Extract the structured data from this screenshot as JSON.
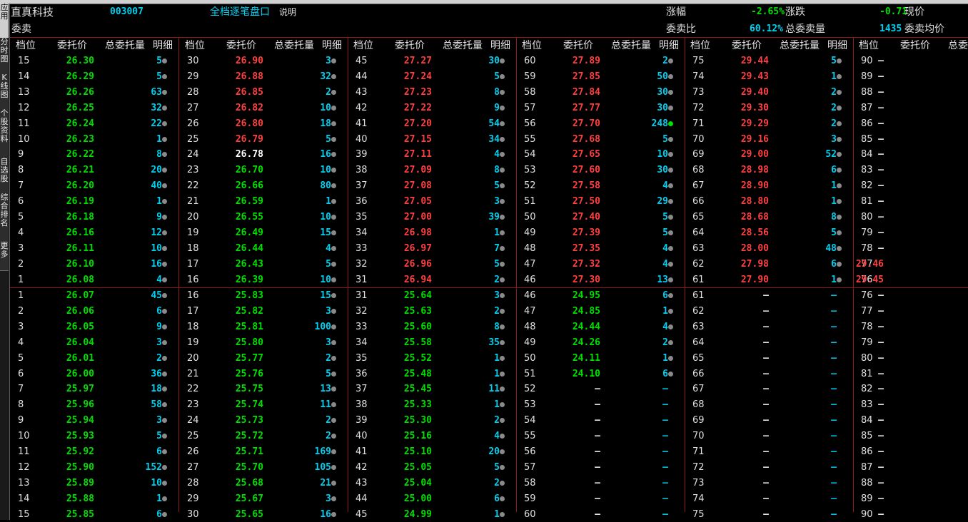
{
  "header": {
    "stock_name": "直真科技",
    "stock_code": "003007",
    "mode_title": "全档逐笔盘口",
    "help_link": "说明",
    "change_pct_label": "涨幅",
    "change_pct_value": "-2.65%",
    "change_label": "涨跌",
    "change_value": "-0.71",
    "price_label": "现价",
    "sell_label": "委卖",
    "sell_ratio_label": "委卖比",
    "sell_ratio_value": "60.12%",
    "sell_total_label": "总委卖量",
    "sell_total_value": "1435",
    "sell_avg_label": "委卖均价"
  },
  "sidebar_tabs": [
    {
      "label": "应用",
      "active": true
    },
    {
      "label": "分时图",
      "active": false
    },
    {
      "label": "K线图",
      "active": false
    },
    {
      "label": "个股资料",
      "active": false
    },
    {
      "label": "自选股",
      "active": false
    },
    {
      "label": "综合排名",
      "active": false
    },
    {
      "label": "更多",
      "active": false
    }
  ],
  "column_headers": {
    "level": "档位",
    "price": "委托价",
    "volume": "总委托量",
    "detail": "明细"
  },
  "colors": {
    "up": "#ff4040",
    "down": "#00e000",
    "flat": "#ffffff",
    "volume": "#00d0f0",
    "dash_price": "#e0e0e0",
    "dash_volume": "#00c0e0"
  },
  "ask_columns": [
    [
      [
        "15",
        "26.30",
        "5",
        "down",
        1
      ],
      [
        "14",
        "26.29",
        "5",
        "down",
        1
      ],
      [
        "13",
        "26.26",
        "63",
        "down",
        1
      ],
      [
        "12",
        "26.25",
        "32",
        "down",
        1
      ],
      [
        "11",
        "26.24",
        "22",
        "down",
        1
      ],
      [
        "10",
        "26.23",
        "1",
        "down",
        1
      ],
      [
        "9",
        "26.22",
        "8",
        "down",
        1
      ],
      [
        "8",
        "26.21",
        "20",
        "down",
        1
      ],
      [
        "7",
        "26.20",
        "40",
        "down",
        1
      ],
      [
        "6",
        "26.19",
        "1",
        "down",
        1
      ],
      [
        "5",
        "26.18",
        "9",
        "down",
        1
      ],
      [
        "4",
        "26.16",
        "12",
        "down",
        1
      ],
      [
        "3",
        "26.11",
        "10",
        "down",
        1
      ],
      [
        "2",
        "26.10",
        "16",
        "down",
        1
      ],
      [
        "1",
        "26.08",
        "4",
        "down",
        1
      ]
    ],
    [
      [
        "30",
        "26.90",
        "3",
        "up",
        1
      ],
      [
        "29",
        "26.88",
        "32",
        "up",
        1
      ],
      [
        "28",
        "26.85",
        "2",
        "up",
        1
      ],
      [
        "27",
        "26.82",
        "10",
        "up",
        1
      ],
      [
        "26",
        "26.80",
        "18",
        "up",
        1
      ],
      [
        "25",
        "26.79",
        "5",
        "up",
        1
      ],
      [
        "24",
        "26.78",
        "16",
        "flat",
        1
      ],
      [
        "23",
        "26.70",
        "10",
        "down",
        1
      ],
      [
        "22",
        "26.66",
        "80",
        "down",
        1
      ],
      [
        "21",
        "26.59",
        "1",
        "down",
        1
      ],
      [
        "20",
        "26.55",
        "10",
        "down",
        1
      ],
      [
        "19",
        "26.49",
        "15",
        "down",
        1
      ],
      [
        "18",
        "26.44",
        "4",
        "down",
        1
      ],
      [
        "17",
        "26.43",
        "5",
        "down",
        1
      ],
      [
        "16",
        "26.39",
        "10",
        "down",
        1
      ]
    ],
    [
      [
        "45",
        "27.27",
        "30",
        "up",
        1
      ],
      [
        "44",
        "27.24",
        "5",
        "up",
        1
      ],
      [
        "43",
        "27.23",
        "8",
        "up",
        1
      ],
      [
        "42",
        "27.22",
        "9",
        "up",
        1
      ],
      [
        "41",
        "27.20",
        "54",
        "up",
        1
      ],
      [
        "40",
        "27.15",
        "34",
        "up",
        1
      ],
      [
        "39",
        "27.11",
        "4",
        "up",
        1
      ],
      [
        "38",
        "27.09",
        "8",
        "up",
        1
      ],
      [
        "37",
        "27.08",
        "5",
        "up",
        1
      ],
      [
        "36",
        "27.05",
        "3",
        "up",
        1
      ],
      [
        "35",
        "27.00",
        "39",
        "up",
        1
      ],
      [
        "34",
        "26.98",
        "1",
        "up",
        1
      ],
      [
        "33",
        "26.97",
        "7",
        "up",
        1
      ],
      [
        "32",
        "26.96",
        "5",
        "up",
        1
      ],
      [
        "31",
        "26.94",
        "2",
        "up",
        1
      ]
    ],
    [
      [
        "60",
        "27.89",
        "2",
        "up",
        1
      ],
      [
        "59",
        "27.85",
        "50",
        "up",
        1
      ],
      [
        "58",
        "27.84",
        "30",
        "up",
        1
      ],
      [
        "57",
        "27.77",
        "30",
        "up",
        1
      ],
      [
        "56",
        "27.70",
        "248",
        "up",
        2
      ],
      [
        "55",
        "27.68",
        "5",
        "up",
        1
      ],
      [
        "54",
        "27.65",
        "10",
        "up",
        1
      ],
      [
        "53",
        "27.60",
        "30",
        "up",
        1
      ],
      [
        "52",
        "27.58",
        "4",
        "up",
        1
      ],
      [
        "51",
        "27.50",
        "29",
        "up",
        1
      ],
      [
        "50",
        "27.40",
        "5",
        "up",
        1
      ],
      [
        "49",
        "27.39",
        "5",
        "up",
        1
      ],
      [
        "48",
        "27.35",
        "4",
        "up",
        1
      ],
      [
        "47",
        "27.32",
        "4",
        "up",
        1
      ],
      [
        "46",
        "27.30",
        "13",
        "up",
        1
      ]
    ],
    [
      [
        "75",
        "29.44",
        "5",
        "up",
        1
      ],
      [
        "74",
        "29.43",
        "1",
        "up",
        1
      ],
      [
        "73",
        "29.40",
        "2",
        "up",
        1
      ],
      [
        "72",
        "29.30",
        "2",
        "up",
        1
      ],
      [
        "71",
        "29.29",
        "2",
        "up",
        1
      ],
      [
        "70",
        "29.16",
        "3",
        "up",
        1
      ],
      [
        "69",
        "29.00",
        "52",
        "up",
        1
      ],
      [
        "68",
        "28.98",
        "6",
        "up",
        1
      ],
      [
        "67",
        "28.90",
        "1",
        "up",
        1
      ],
      [
        "66",
        "28.80",
        "1",
        "up",
        1
      ],
      [
        "65",
        "28.68",
        "8",
        "up",
        1
      ],
      [
        "64",
        "28.56",
        "5",
        "up",
        1
      ],
      [
        "63",
        "28.00",
        "48",
        "up",
        1
      ],
      [
        "62",
        "27.98",
        "6",
        "up",
        1
      ],
      [
        "61",
        "27.90",
        "1",
        "up",
        1
      ]
    ],
    [
      [
        "90",
        "–",
        "",
        "dash",
        0
      ],
      [
        "89",
        "–",
        "",
        "dash",
        0
      ],
      [
        "88",
        "–",
        "",
        "dash",
        0
      ],
      [
        "87",
        "–",
        "",
        "dash",
        0
      ],
      [
        "86",
        "–",
        "",
        "dash",
        0
      ],
      [
        "85",
        "–",
        "",
        "dash",
        0
      ],
      [
        "84",
        "–",
        "",
        "dash",
        0
      ],
      [
        "83",
        "–",
        "",
        "dash",
        0
      ],
      [
        "82",
        "–",
        "",
        "dash",
        0
      ],
      [
        "81",
        "–",
        "",
        "dash",
        0
      ],
      [
        "80",
        "–",
        "",
        "dash",
        0
      ],
      [
        "79",
        "–",
        "",
        "dash",
        0
      ],
      [
        "78",
        "–",
        "",
        "dash",
        0
      ],
      [
        "77",
        "29.46",
        "",
        "up",
        0
      ],
      [
        "76",
        "29.45",
        "",
        "up",
        0
      ]
    ]
  ],
  "bid_columns": [
    [
      [
        "1",
        "26.07",
        "45",
        "down",
        1
      ],
      [
        "2",
        "26.06",
        "6",
        "down",
        1
      ],
      [
        "3",
        "26.05",
        "9",
        "down",
        1
      ],
      [
        "4",
        "26.04",
        "3",
        "down",
        1
      ],
      [
        "5",
        "26.01",
        "2",
        "down",
        1
      ],
      [
        "6",
        "26.00",
        "36",
        "down",
        1
      ],
      [
        "7",
        "25.97",
        "18",
        "down",
        1
      ],
      [
        "8",
        "25.96",
        "58",
        "down",
        1
      ],
      [
        "9",
        "25.94",
        "3",
        "down",
        1
      ],
      [
        "10",
        "25.93",
        "5",
        "down",
        1
      ],
      [
        "11",
        "25.92",
        "6",
        "down",
        1
      ],
      [
        "12",
        "25.90",
        "152",
        "down",
        1
      ],
      [
        "13",
        "25.89",
        "10",
        "down",
        1
      ],
      [
        "14",
        "25.88",
        "1",
        "down",
        1
      ],
      [
        "15",
        "25.85",
        "6",
        "down",
        1
      ]
    ],
    [
      [
        "16",
        "25.83",
        "15",
        "down",
        1
      ],
      [
        "17",
        "25.82",
        "3",
        "down",
        1
      ],
      [
        "18",
        "25.81",
        "100",
        "down",
        1
      ],
      [
        "19",
        "25.80",
        "3",
        "down",
        1
      ],
      [
        "20",
        "25.77",
        "2",
        "down",
        1
      ],
      [
        "21",
        "25.76",
        "5",
        "down",
        1
      ],
      [
        "22",
        "25.75",
        "13",
        "down",
        1
      ],
      [
        "23",
        "25.74",
        "11",
        "down",
        1
      ],
      [
        "24",
        "25.73",
        "2",
        "down",
        1
      ],
      [
        "25",
        "25.72",
        "2",
        "down",
        1
      ],
      [
        "26",
        "25.71",
        "169",
        "down",
        1
      ],
      [
        "27",
        "25.70",
        "105",
        "down",
        1
      ],
      [
        "28",
        "25.68",
        "21",
        "down",
        1
      ],
      [
        "29",
        "25.67",
        "3",
        "down",
        1
      ],
      [
        "30",
        "25.65",
        "16",
        "down",
        1
      ]
    ],
    [
      [
        "31",
        "25.64",
        "3",
        "down",
        1
      ],
      [
        "32",
        "25.63",
        "2",
        "down",
        1
      ],
      [
        "33",
        "25.60",
        "8",
        "down",
        1
      ],
      [
        "34",
        "25.58",
        "35",
        "down",
        1
      ],
      [
        "35",
        "25.52",
        "1",
        "down",
        1
      ],
      [
        "36",
        "25.48",
        "1",
        "down",
        1
      ],
      [
        "37",
        "25.45",
        "11",
        "down",
        1
      ],
      [
        "38",
        "25.33",
        "1",
        "down",
        1
      ],
      [
        "39",
        "25.30",
        "2",
        "down",
        1
      ],
      [
        "40",
        "25.16",
        "4",
        "down",
        1
      ],
      [
        "41",
        "25.10",
        "20",
        "down",
        1
      ],
      [
        "42",
        "25.05",
        "5",
        "down",
        1
      ],
      [
        "43",
        "25.04",
        "2",
        "down",
        1
      ],
      [
        "44",
        "25.00",
        "6",
        "down",
        1
      ],
      [
        "45",
        "24.99",
        "1",
        "down",
        1
      ]
    ],
    [
      [
        "46",
        "24.95",
        "6",
        "down",
        1
      ],
      [
        "47",
        "24.85",
        "1",
        "down",
        1
      ],
      [
        "48",
        "24.44",
        "4",
        "down",
        1
      ],
      [
        "49",
        "24.26",
        "2",
        "down",
        1
      ],
      [
        "50",
        "24.11",
        "1",
        "down",
        1
      ],
      [
        "51",
        "24.10",
        "6",
        "down",
        1
      ],
      [
        "52",
        "–",
        "–",
        "dash",
        0
      ],
      [
        "53",
        "–",
        "–",
        "dash",
        0
      ],
      [
        "54",
        "–",
        "–",
        "dash",
        0
      ],
      [
        "55",
        "–",
        "–",
        "dash",
        0
      ],
      [
        "56",
        "–",
        "–",
        "dash",
        0
      ],
      [
        "57",
        "–",
        "–",
        "dash",
        0
      ],
      [
        "58",
        "–",
        "–",
        "dash",
        0
      ],
      [
        "59",
        "–",
        "–",
        "dash",
        0
      ],
      [
        "60",
        "–",
        "–",
        "dash",
        0
      ]
    ],
    [
      [
        "61",
        "–",
        "–",
        "dash",
        0
      ],
      [
        "62",
        "–",
        "–",
        "dash",
        0
      ],
      [
        "63",
        "–",
        "–",
        "dash",
        0
      ],
      [
        "64",
        "–",
        "–",
        "dash",
        0
      ],
      [
        "65",
        "–",
        "–",
        "dash",
        0
      ],
      [
        "66",
        "–",
        "–",
        "dash",
        0
      ],
      [
        "67",
        "–",
        "–",
        "dash",
        0
      ],
      [
        "68",
        "–",
        "–",
        "dash",
        0
      ],
      [
        "69",
        "–",
        "–",
        "dash",
        0
      ],
      [
        "70",
        "–",
        "–",
        "dash",
        0
      ],
      [
        "71",
        "–",
        "–",
        "dash",
        0
      ],
      [
        "72",
        "–",
        "–",
        "dash",
        0
      ],
      [
        "73",
        "–",
        "–",
        "dash",
        0
      ],
      [
        "74",
        "–",
        "–",
        "dash",
        0
      ],
      [
        "75",
        "–",
        "–",
        "dash",
        0
      ]
    ],
    [
      [
        "76",
        "–",
        "",
        "dash",
        0
      ],
      [
        "77",
        "–",
        "",
        "dash",
        0
      ],
      [
        "78",
        "–",
        "",
        "dash",
        0
      ],
      [
        "79",
        "–",
        "",
        "dash",
        0
      ],
      [
        "80",
        "–",
        "",
        "dash",
        0
      ],
      [
        "81",
        "–",
        "",
        "dash",
        0
      ],
      [
        "82",
        "–",
        "",
        "dash",
        0
      ],
      [
        "83",
        "–",
        "",
        "dash",
        0
      ],
      [
        "84",
        "–",
        "",
        "dash",
        0
      ],
      [
        "85",
        "–",
        "",
        "dash",
        0
      ],
      [
        "86",
        "–",
        "",
        "dash",
        0
      ],
      [
        "87",
        "–",
        "",
        "dash",
        0
      ],
      [
        "88",
        "–",
        "",
        "dash",
        0
      ],
      [
        "89",
        "–",
        "",
        "dash",
        0
      ],
      [
        "90",
        "–",
        "",
        "dash",
        0
      ]
    ]
  ]
}
